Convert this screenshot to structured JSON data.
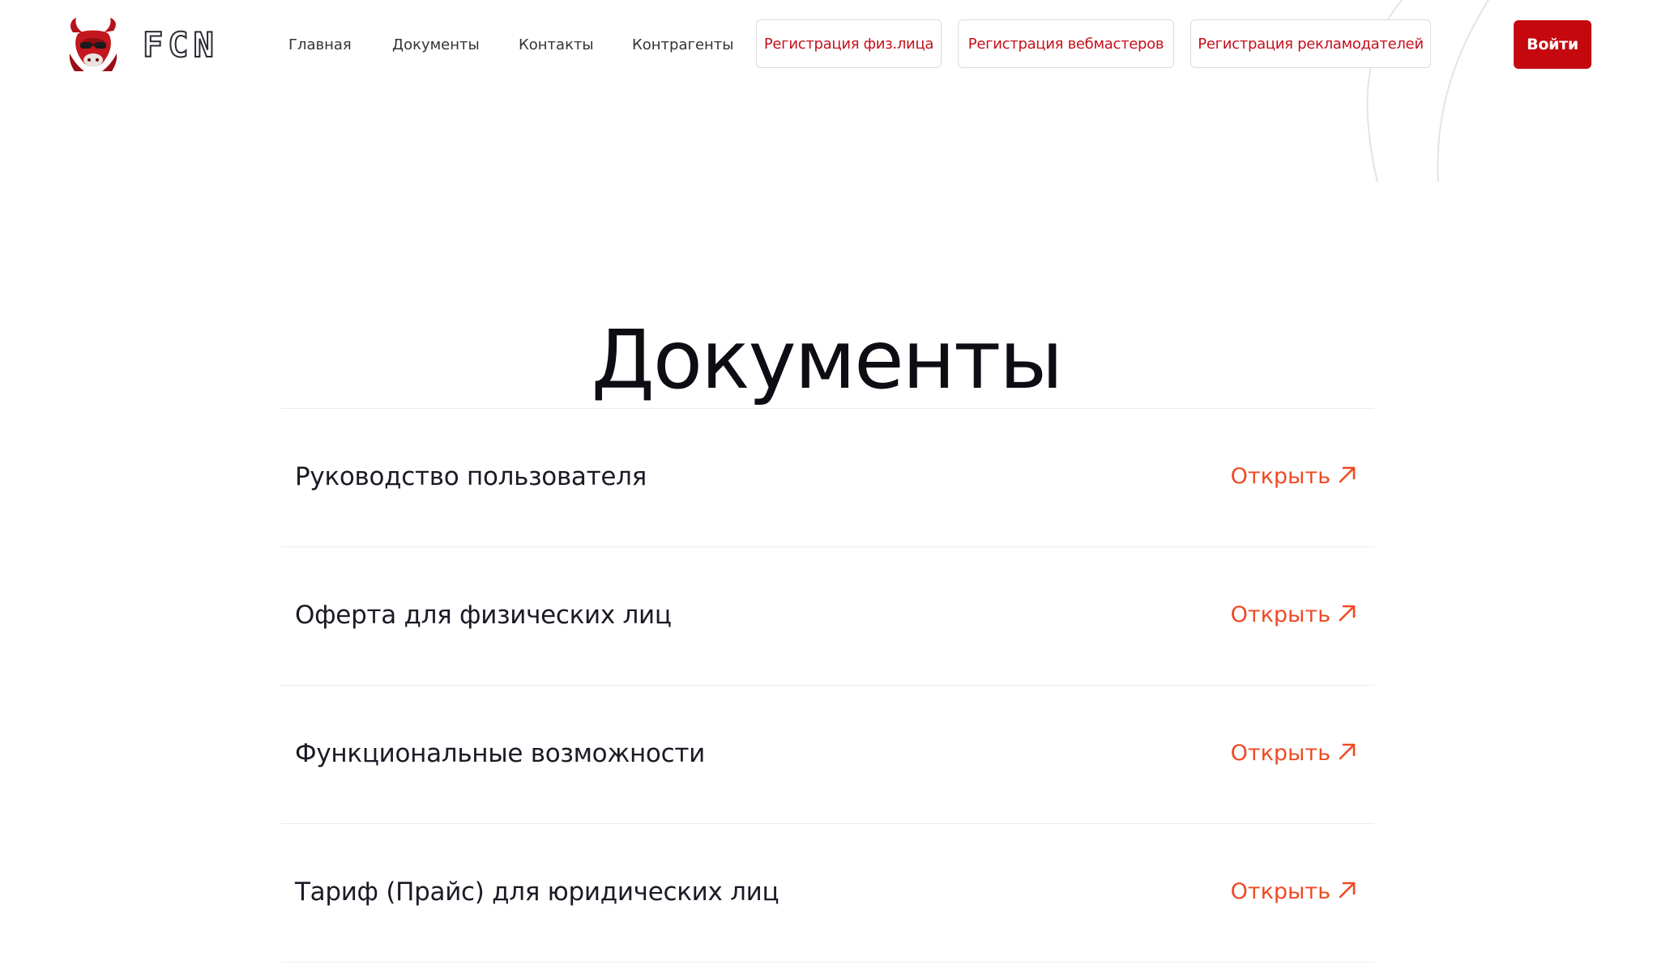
{
  "brand": {
    "name": "FCN",
    "logo_icon": "bull-head-logo-icon",
    "accent_color": "#c4080e"
  },
  "nav": {
    "links": [
      {
        "label": "Главная"
      },
      {
        "label": "Документы"
      },
      {
        "label": "Контакты"
      },
      {
        "label": "Контрагенты"
      }
    ],
    "buttons": [
      {
        "label": "Регистрация физ.лица"
      },
      {
        "label": "Регистрация вебмастеров"
      },
      {
        "label": "Регистрация рекламодателей"
      }
    ],
    "login_label": "Войти"
  },
  "main": {
    "title": "Документы",
    "documents": [
      {
        "name": "Руководство пользователя",
        "action": "Открыть",
        "icon": "arrow-up-right-icon"
      },
      {
        "name": "Оферта для физических лиц",
        "action": "Открыть",
        "icon": "arrow-up-right-icon"
      },
      {
        "name": "Функциональные возможности",
        "action": "Открыть",
        "icon": "arrow-up-right-icon"
      },
      {
        "name": "Тариф (Прайс) для юридических лиц",
        "action": "Открыть",
        "icon": "arrow-up-right-icon"
      }
    ],
    "action_color": "#ef4a24"
  }
}
